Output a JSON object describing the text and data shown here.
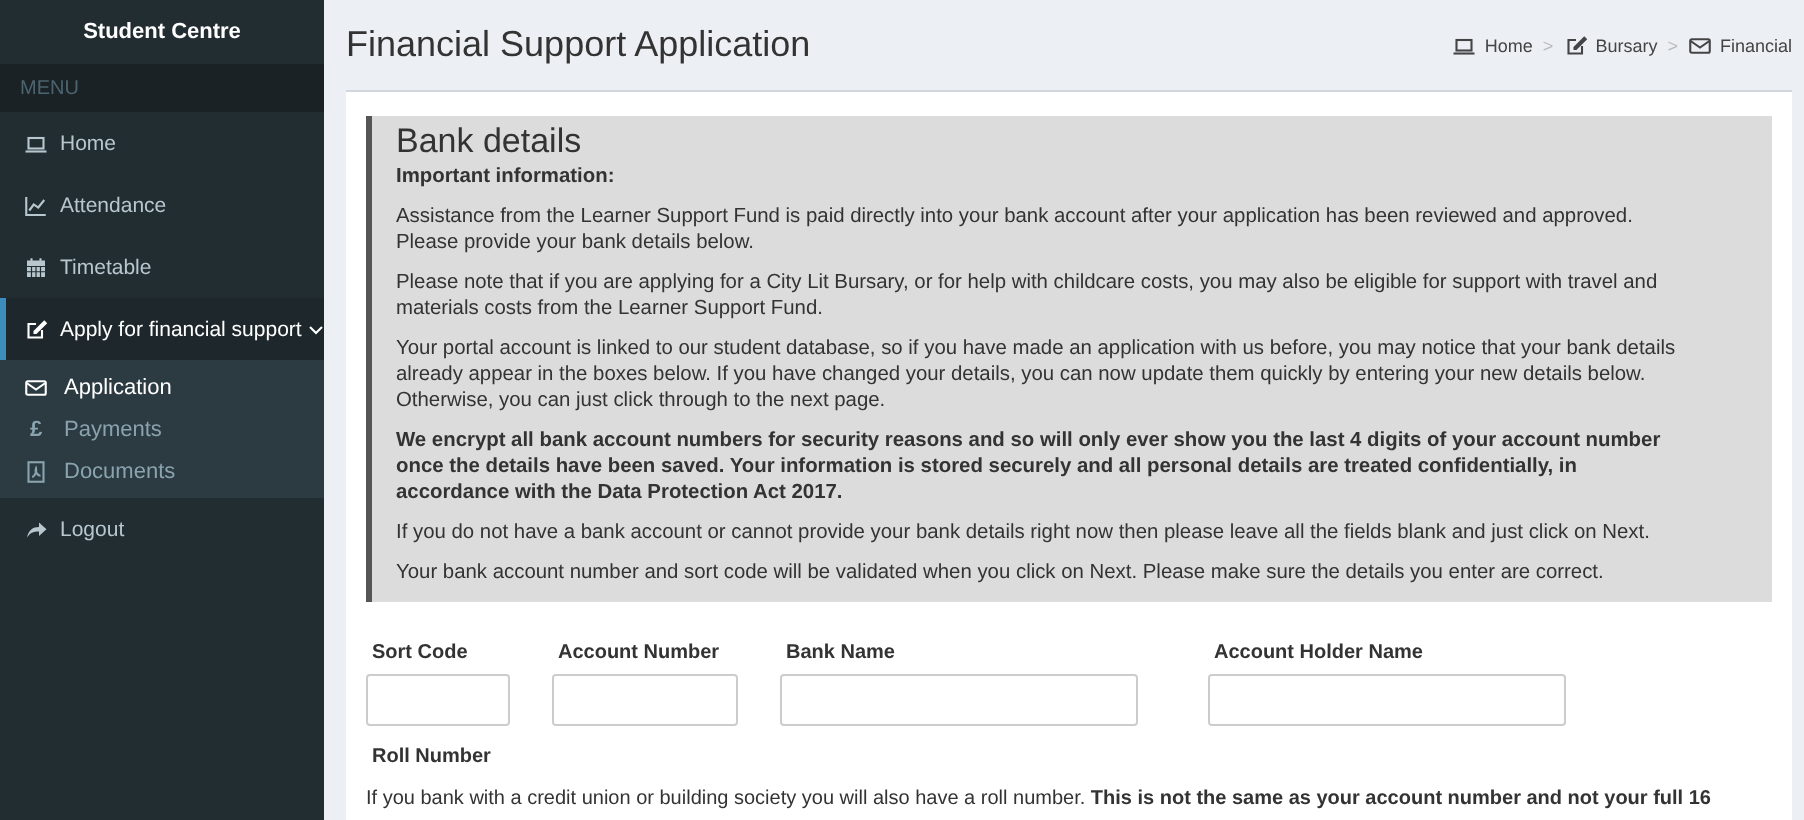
{
  "sidebar": {
    "title": "Student Centre",
    "header": "MENU",
    "items": [
      {
        "label": "Home",
        "selected": false
      },
      {
        "label": "Attendance",
        "selected": false
      },
      {
        "label": "Timetable",
        "selected": false
      },
      {
        "label": "Apply for financial support",
        "selected": true,
        "expanded": true,
        "children": [
          {
            "label": "Application",
            "selected": true
          },
          {
            "label": "Payments",
            "selected": false,
            "glyph": "£"
          },
          {
            "label": "Documents",
            "selected": false
          }
        ]
      },
      {
        "label": "Logout",
        "selected": false
      }
    ]
  },
  "page": {
    "title": "Financial Support Application",
    "breadcrumb": [
      "Home",
      "Bursary",
      "Financial"
    ],
    "separator": ">"
  },
  "callout": {
    "title": "Bank details",
    "heading": "Important information:",
    "paragraphs": [
      {
        "text": "Assistance from the Learner Support Fund is paid directly into your bank account after your application has been reviewed and approved. Please provide your bank details below.",
        "bold": false
      },
      {
        "text": "Please note that if you are applying for a City Lit Bursary, or for help with childcare costs, you may also be eligible for support with travel and materials costs from the Learner Support Fund.",
        "bold": false
      },
      {
        "text": "Your portal account is linked to our student database, so if you have made an application with us before, you may notice that your bank details already appear in the boxes below. If you have changed your details, you can now update them quickly by entering your new details below. Otherwise, you can just click through to the next page.",
        "bold": false
      },
      {
        "text": "We encrypt all bank account numbers for security reasons and so will only ever show you the last 4 digits of your account number once the details have been saved. Your information is stored securely and all personal details are treated confidentially, in accordance with the Data Protection Act 2017.",
        "bold": true
      },
      {
        "text": "If you do not have a bank account or cannot provide your bank details right now then please leave all the fields blank and just click on Next.",
        "bold": false
      },
      {
        "text": "Your bank account number and sort code will be validated when you click on Next. Please make sure the details you enter are correct.",
        "bold": false
      }
    ]
  },
  "form": {
    "fields": [
      {
        "label": "Sort Code"
      },
      {
        "label": "Account Number"
      },
      {
        "label": "Bank Name"
      },
      {
        "label": "Account Holder Name"
      }
    ],
    "roll_number": {
      "label": "Roll Number",
      "text": "If you bank with a credit union or building society you will also have a roll number. **This is not the same as your account number and not your full 16**"
    }
  }
}
